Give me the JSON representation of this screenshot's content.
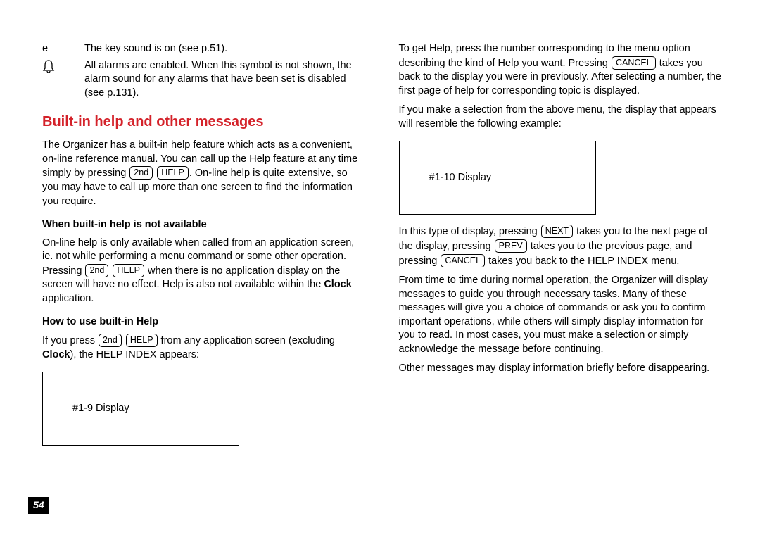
{
  "pageNumber": "54",
  "iconRows": [
    {
      "icon": "e",
      "text": "The key sound is on (see p.51)."
    },
    {
      "icon": "🔔",
      "text": "All alarms are enabled. When this symbol is not shown, the alarm sound for any alarms that have been set is disabled (see p.131)."
    }
  ],
  "sectionTitle": "Built-in help and other messages",
  "p1a": "The Organizer has a built-in help feature which acts as a convenient, on-line reference manual. You can call up the Help feature at any time simply by pressing ",
  "p1b": ". On-line help is quite extensive, so you may have to call up more than one screen to find the information you require.",
  "sub1": "When built-in help is not available",
  "p2a": "On-line help is only available when called from an application screen, ie. not while performing a menu command or some other operation. Pressing ",
  "p2b": " when there is no application display on the screen will have no effect. Help is also not available within the ",
  "p2c": " application.",
  "clock": "Clock",
  "sub2": "How to use built-in Help",
  "p3a": "If you press ",
  "p3b": " from any application screen (excluding ",
  "p3c": "), the HELP INDEX appears:",
  "display1": "#1-9 Display",
  "p4a": "To get Help, press the number corresponding to the menu option describing the kind of Help you want. Pressing ",
  "p4b": " takes you back to the display you were in previously. After selecting a number, the first page of help for corresponding topic is displayed.",
  "p5": "If you make a selection from the above menu, the display that appears will resemble the following example:",
  "display2": "#1-10 Display",
  "p6a": "In this type of display, pressing ",
  "p6b": " takes you to the next page of the display, pressing ",
  "p6c": " takes you to the previous page, and pressing ",
  "p6d": " takes you back to the HELP INDEX menu.",
  "p7": "From time to time during normal operation, the Organizer will display messages to guide you through necessary tasks. Many of these messages will give you a choice of commands or ask you to confirm important operations, while others will simply display information for you to read. In most cases, you must make a selection or simply acknowledge the message before continuing.",
  "p8": "Other messages may display information briefly before disappearing.",
  "keys": {
    "second": "2nd",
    "help": "HELP",
    "cancel": "CANCEL",
    "next": "NEXT",
    "prev": "PREV"
  }
}
